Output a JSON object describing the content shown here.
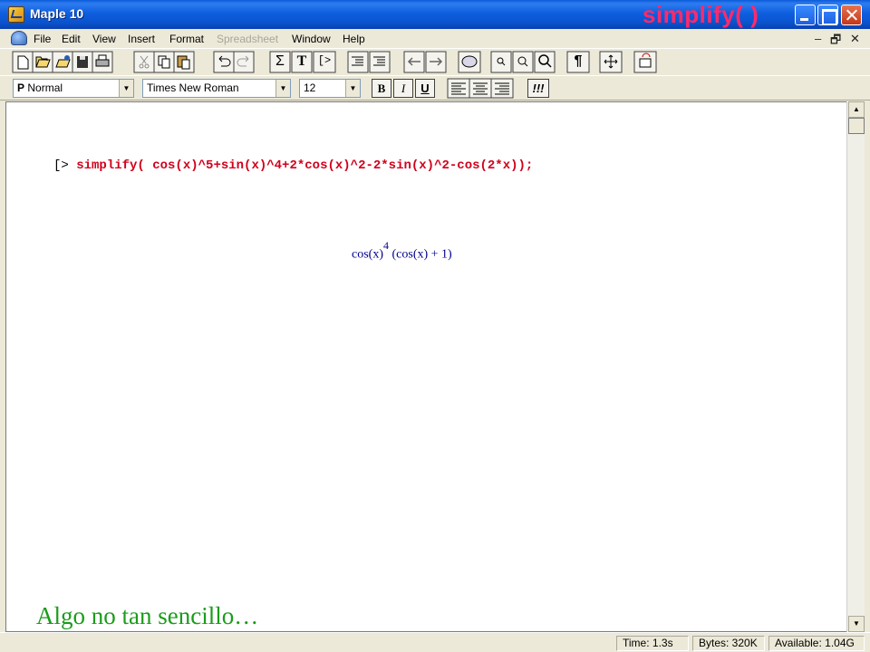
{
  "window": {
    "title": "Maple 10",
    "slide_title": "simplify( )"
  },
  "menu": {
    "items": [
      {
        "label": "File",
        "enabled": true
      },
      {
        "label": "Edit",
        "enabled": true
      },
      {
        "label": "View",
        "enabled": true
      },
      {
        "label": "Insert",
        "enabled": true
      },
      {
        "label": "Format",
        "enabled": true
      },
      {
        "label": "Spreadsheet",
        "enabled": false
      },
      {
        "label": "Window",
        "enabled": true
      },
      {
        "label": "Help",
        "enabled": true
      }
    ],
    "mdi_controls": [
      "–",
      "🗗",
      "✕"
    ]
  },
  "toolbar": {
    "icons": [
      "new-document-icon",
      "open-icon",
      "open-url-icon",
      "save-icon",
      "print-icon",
      "cut-icon",
      "copy-icon",
      "paste-icon",
      "undo-icon",
      "redo-icon",
      "sum-icon",
      "text-icon",
      "execution-group-icon",
      "outdent-icon",
      "indent-icon",
      "back-icon",
      "forward-icon",
      "stop-icon",
      "zoom-small-icon",
      "zoom-medium-icon",
      "zoom-large-icon",
      "paragraph-icon",
      "expand-icon",
      "restart-icon"
    ],
    "sigma": "Σ",
    "text_t": "T",
    "prompt_glyph": "[>",
    "pilcrow": "¶"
  },
  "format_bar": {
    "style_prefix": "P",
    "style_value": "Normal",
    "font_value": "Times New Roman",
    "size_value": "12",
    "bold": "B",
    "italic": "I",
    "underline": "U",
    "exec": "!!!"
  },
  "worksheet": {
    "prompt": "[>",
    "command": "simplify( cos(x)^5+sin(x)^4+2*cos(x)^2-2*sin(x)^2-cos(2*x));",
    "output_base": "cos(x)",
    "output_exponent": "4",
    "output_rest": " (cos(x) + 1)",
    "caption": "Algo no tan sencillo…"
  },
  "status": {
    "time": "Time:  1.3s",
    "bytes": "Bytes:  320K",
    "available": "Available:  1.04G"
  }
}
